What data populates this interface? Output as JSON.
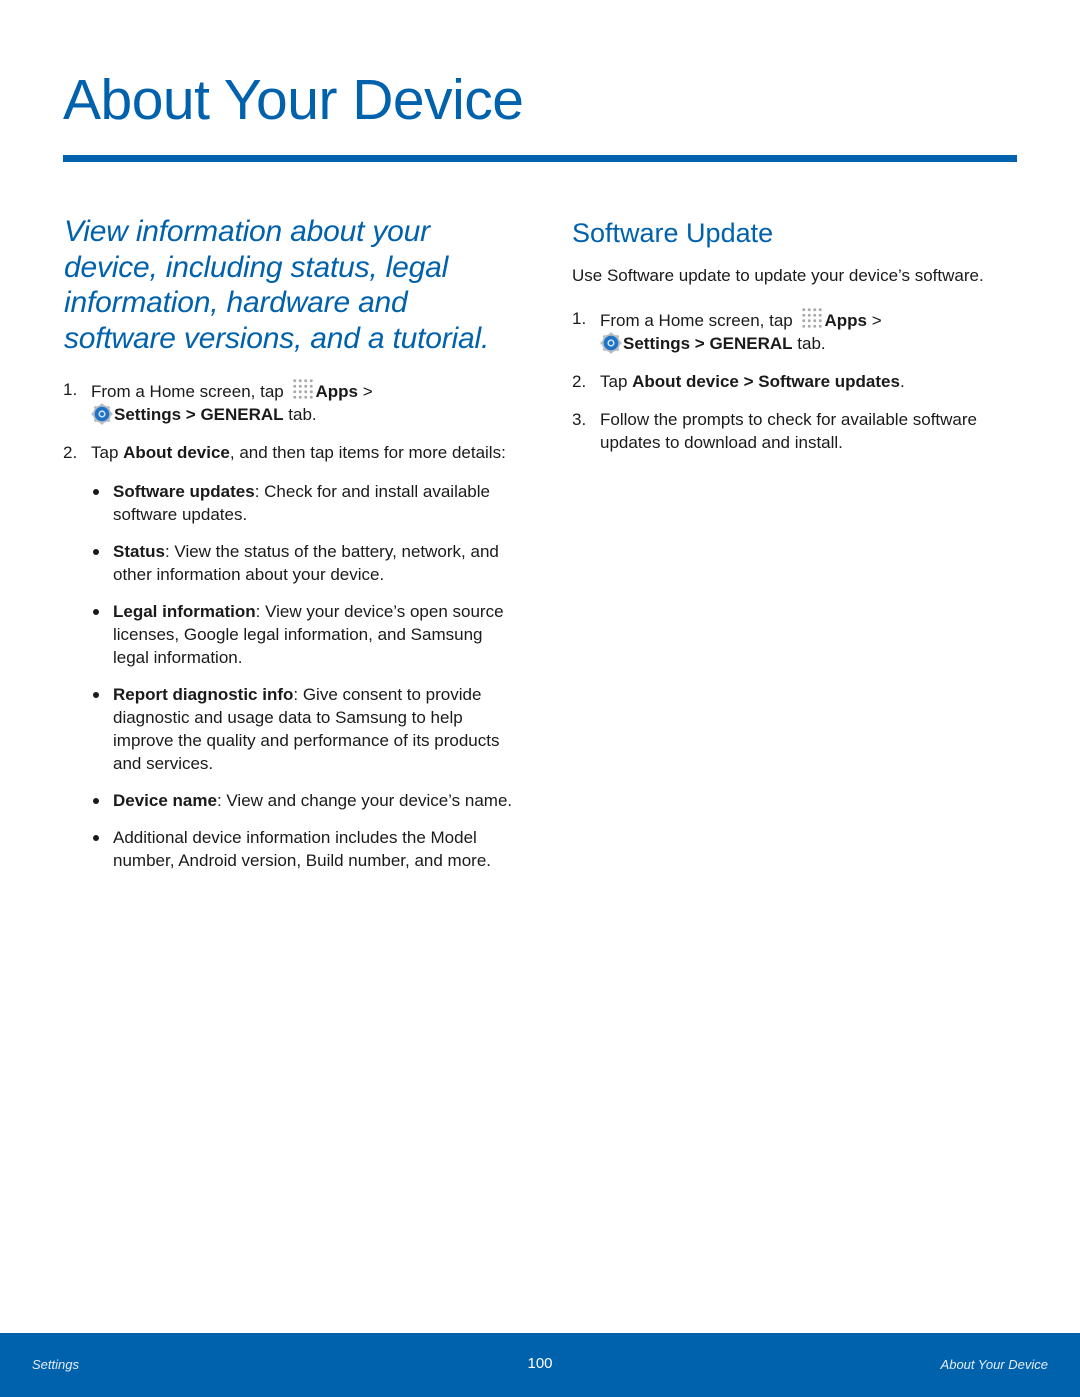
{
  "page": {
    "title": "About Your Device",
    "lead": "View information about your device, including status, legal information, hardware and software versions, and a tutorial.",
    "accent_color": "#0061ad"
  },
  "left": {
    "steps": [
      {
        "num": "1.",
        "pre": "From a Home screen, tap ",
        "apps_label": "Apps",
        "sep1": " > ",
        "settings_label": "Settings",
        "sep2": " > ",
        "general_label": "GENERAL",
        "post": " tab."
      },
      {
        "num": "2.",
        "pre": "Tap ",
        "bold": "About device",
        "post": ", and then tap items for more details:"
      }
    ],
    "bullets": [
      {
        "bold": "Software updates",
        "text": ": Check for and install available software updates."
      },
      {
        "bold": "Status",
        "text": ": View the status of the battery, network, and other information about your device."
      },
      {
        "bold": "Legal information",
        "text": ": View your device’s open source licenses, Google legal information, and Samsung legal information."
      },
      {
        "bold": "Report diagnostic info",
        "text": ": Give consent to provide diagnostic and usage data to Samsung to help improve the quality and performance of its products and services."
      },
      {
        "bold": "Device name",
        "text": ": View and change your device’s name."
      },
      {
        "bold": "",
        "text": "Additional device information includes the Model number, Android version, Build number, and more."
      }
    ]
  },
  "right": {
    "heading": "Software Update",
    "intro": "Use Software update to update your device’s software.",
    "steps": [
      {
        "num": "1.",
        "pre": "From a Home screen, tap ",
        "apps_label": "Apps",
        "sep1": " > ",
        "settings_label": "Settings",
        "sep2": " > ",
        "general_label": "GENERAL",
        "post": " tab."
      },
      {
        "num": "2.",
        "pre": "Tap ",
        "bold1": "About device",
        "sep": " > ",
        "bold2": "Software updates",
        "post": "."
      },
      {
        "num": "3.",
        "text": "Follow the prompts to check for available software updates to download and install."
      }
    ]
  },
  "footer": {
    "left": "Settings",
    "page_number": "100",
    "right": "About Your Device"
  }
}
